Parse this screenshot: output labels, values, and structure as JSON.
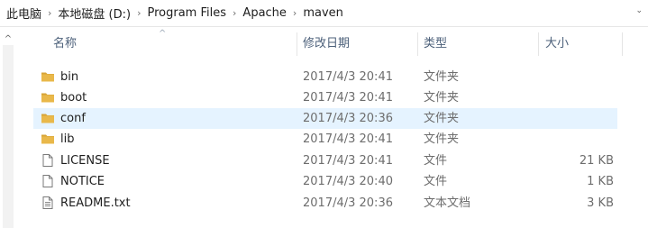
{
  "breadcrumb": {
    "items": [
      "此电脑",
      "本地磁盘 (D:)",
      "Program Files",
      "Apache",
      "maven"
    ],
    "separator": "›",
    "dropdown_glyph": "⌄"
  },
  "columns": {
    "name": "名称",
    "date": "修改日期",
    "type": "类型",
    "size": "大小",
    "sort_indicator": "^"
  },
  "scrollbar": {
    "up_arrow": "^"
  },
  "files": [
    {
      "icon": "folder-icon",
      "name": "bin",
      "date": "2017/4/3 20:41",
      "type": "文件夹",
      "size": ""
    },
    {
      "icon": "folder-icon",
      "name": "boot",
      "date": "2017/4/3 20:41",
      "type": "文件夹",
      "size": ""
    },
    {
      "icon": "folder-icon",
      "name": "conf",
      "date": "2017/4/3 20:36",
      "type": "文件夹",
      "size": "",
      "selected": true
    },
    {
      "icon": "folder-icon",
      "name": "lib",
      "date": "2017/4/3 20:41",
      "type": "文件夹",
      "size": ""
    },
    {
      "icon": "file-icon",
      "name": "LICENSE",
      "date": "2017/4/3 20:41",
      "type": "文件",
      "size": "21 KB"
    },
    {
      "icon": "file-icon",
      "name": "NOTICE",
      "date": "2017/4/3 20:40",
      "type": "文件",
      "size": "1 KB"
    },
    {
      "icon": "text-document-icon",
      "name": "README.txt",
      "date": "2017/4/3 20:36",
      "type": "文本文档",
      "size": "3 KB"
    }
  ],
  "colors": {
    "folder": "#e9b84a",
    "folder_dark": "#d7a437",
    "selection": "#e5f3ff",
    "header_text": "#4c607a"
  }
}
